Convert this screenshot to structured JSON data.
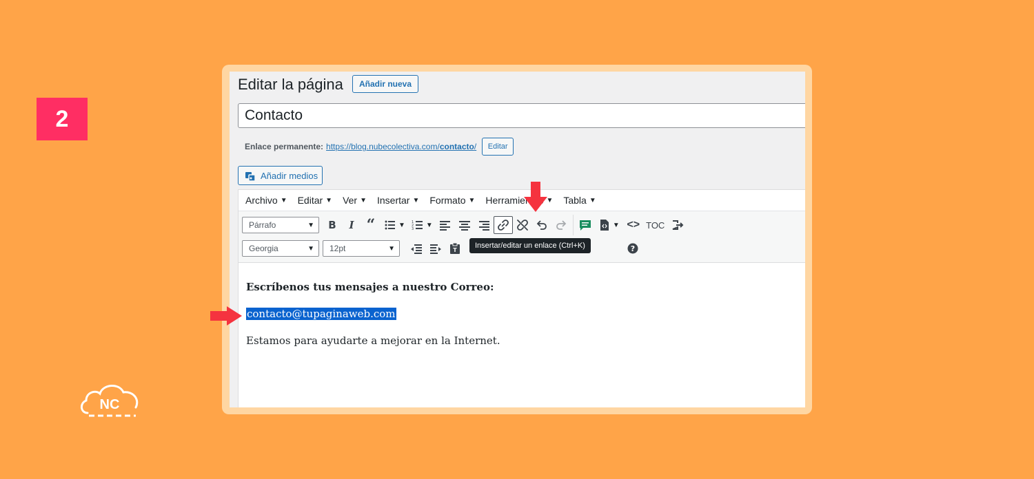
{
  "step_number": "2",
  "logo_text": "NC",
  "page": {
    "heading": "Editar la página",
    "add_new_label": "Añadir nueva",
    "title_value": "Contacto",
    "permalink_label": "Enlace permanente:",
    "permalink_prefix": "https://blog.nubecolectiva.com/",
    "permalink_slug": "contacto",
    "permalink_suffix": "/",
    "edit_slug_label": "Editar",
    "add_media_label": "Añadir medios"
  },
  "menubar": [
    "Archivo",
    "Editar",
    "Ver",
    "Insertar",
    "Formato",
    "Herramientas",
    "Tabla"
  ],
  "toolbar": {
    "format_select": "Párrafo",
    "font_select": "Georgia",
    "size_select": "12pt",
    "toc_label": "TOC",
    "tooltip": "Insertar/editar un enlace (Ctrl+K)"
  },
  "content": {
    "heading": "Escríbenos tus mensajes a nuestro Correo:",
    "email": "contacto@tupaginaweb.com",
    "paragraph": "Estamos para ayudarte a mejorar en la Internet."
  },
  "colors": {
    "background": "#FFA448",
    "badge": "#FF2E63",
    "arrow": "#F5333F",
    "link": "#2271b1",
    "selection": "#0a63cf"
  }
}
